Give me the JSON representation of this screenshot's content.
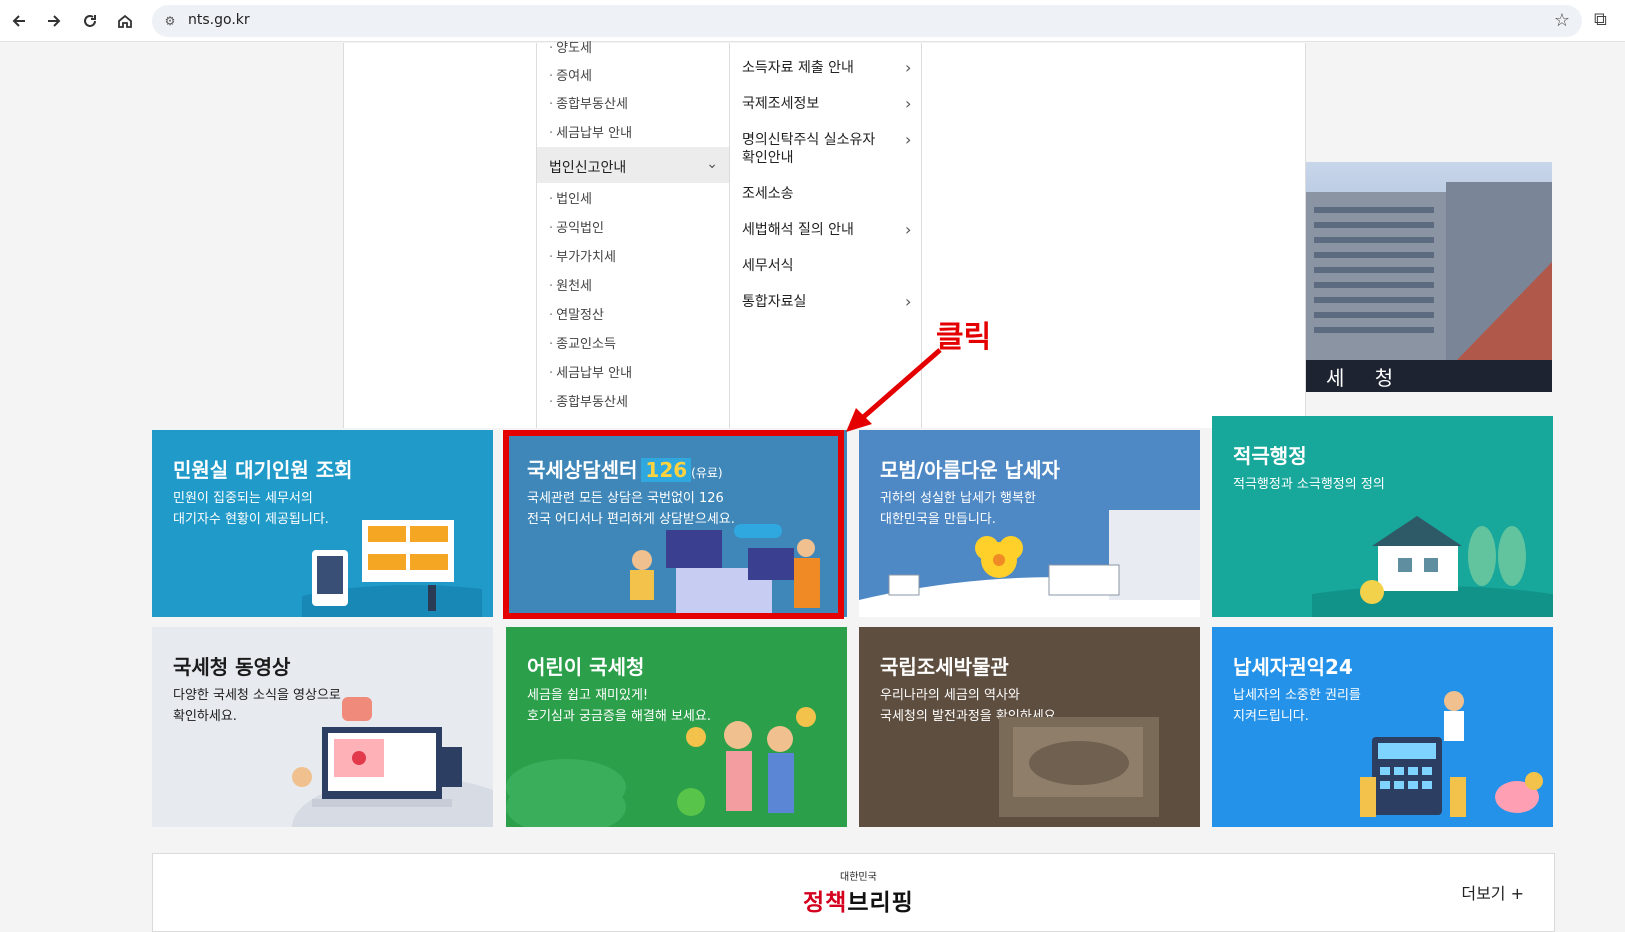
{
  "browser": {
    "url": "nts.go.kr",
    "back_icon": "arrow-left-icon",
    "forward_icon": "arrow-right-icon",
    "reload_icon": "reload-icon",
    "home_icon": "home-icon"
  },
  "menu": {
    "col_a_top": [
      "양도세",
      "증여세",
      "종합부동산세",
      "세금납부 안내"
    ],
    "section_head": "법인신고안내",
    "col_a_bottom": [
      "법인세",
      "공익법인",
      "부가가치세",
      "원천세",
      "연말정산",
      "종교인소득",
      "세금납부 안내",
      "종합부동산세"
    ],
    "col_b": [
      {
        "label": "소득자료 제출 안내",
        "has_chevron": true
      },
      {
        "label": "국제조세정보",
        "has_chevron": true
      },
      {
        "label": "명의신탁주식 실소유자 확인안내",
        "has_chevron": true
      },
      {
        "label": "조세소송",
        "has_chevron": false
      },
      {
        "label": "세법해석 질의 안내",
        "has_chevron": true
      },
      {
        "label": "세무서식",
        "has_chevron": false
      },
      {
        "label": "통합자료실",
        "has_chevron": true
      }
    ]
  },
  "photo_caption": "세 청",
  "tiles": {
    "t1": {
      "title": "민원실 대기인원 조회",
      "desc": "민원이 집중되는 세무서의\n대기자수 현황이 제공됩니다."
    },
    "t2": {
      "title": "국세상담센터",
      "badge": "126",
      "badge_suffix": "(유료)",
      "desc": "국세관련 모든 상담은 국번없이 126\n전국 어디서나 편리하게 상담받으세요."
    },
    "t3": {
      "title": "모범/아름다운 납세자",
      "desc": "귀하의 성실한 납세가 행복한\n대한민국을 만듭니다."
    },
    "t4": {
      "title": "적극행정",
      "desc": "적극행정과 소극행정의 정의"
    },
    "t5": {
      "title": "국세청 동영상",
      "desc": "다양한 국세청 소식을 영상으로\n확인하세요."
    },
    "t6": {
      "title": "어린이 국세청",
      "desc": "세금을 쉽고 재미있게!\n호기심과 궁금증을 해결해 보세요."
    },
    "t7": {
      "title": "국립조세박물관",
      "desc": "우리나라의 세금의 역사와\n국세청의 발전과정을 확인하세요."
    },
    "t8": {
      "title": "납세자권익24",
      "desc": "납세자의 소중한 권리를\n지켜드립니다."
    }
  },
  "annotation": "클릭",
  "briefing": {
    "small": "대한민국",
    "big_a": "정책",
    "big_b": "브리핑",
    "more": "더보기 +"
  },
  "colors": {
    "highlight": "#e40000",
    "t1": "#1f9ac9",
    "t2": "#3f87b8",
    "t3": "#4f89c5",
    "t4": "#17a79b",
    "t6": "#2c9f4b",
    "t8": "#2392e8"
  }
}
